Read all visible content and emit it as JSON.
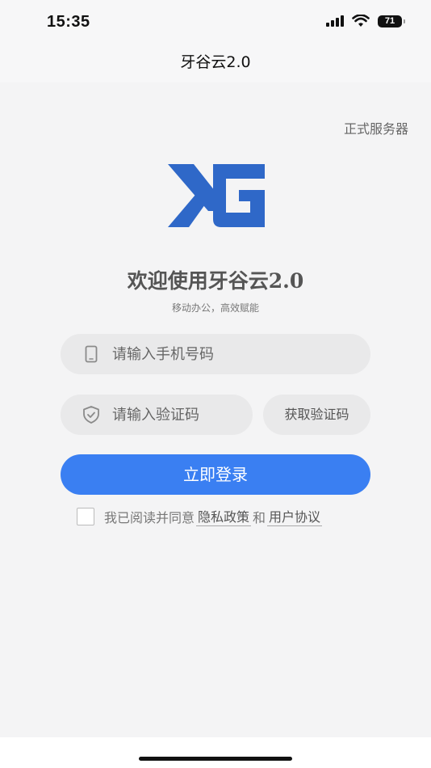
{
  "status_bar": {
    "time": "15:35",
    "battery": "71"
  },
  "nav": {
    "title": "牙谷云2.0"
  },
  "server_link": "正式服务器",
  "welcome": {
    "title": "欢迎使用牙谷云2.0",
    "subtitle": "移动办公，高效赋能"
  },
  "form": {
    "phone_placeholder": "请输入手机号码",
    "code_placeholder": "请输入验证码",
    "get_code_label": "获取验证码",
    "login_label": "立即登录"
  },
  "agreement": {
    "prefix": "我已阅读并同意",
    "privacy": "隐私政策",
    "conjunction": "和",
    "terms": "用户协议"
  },
  "colors": {
    "primary": "#3a7ff2",
    "logo": "#2f68c8"
  }
}
